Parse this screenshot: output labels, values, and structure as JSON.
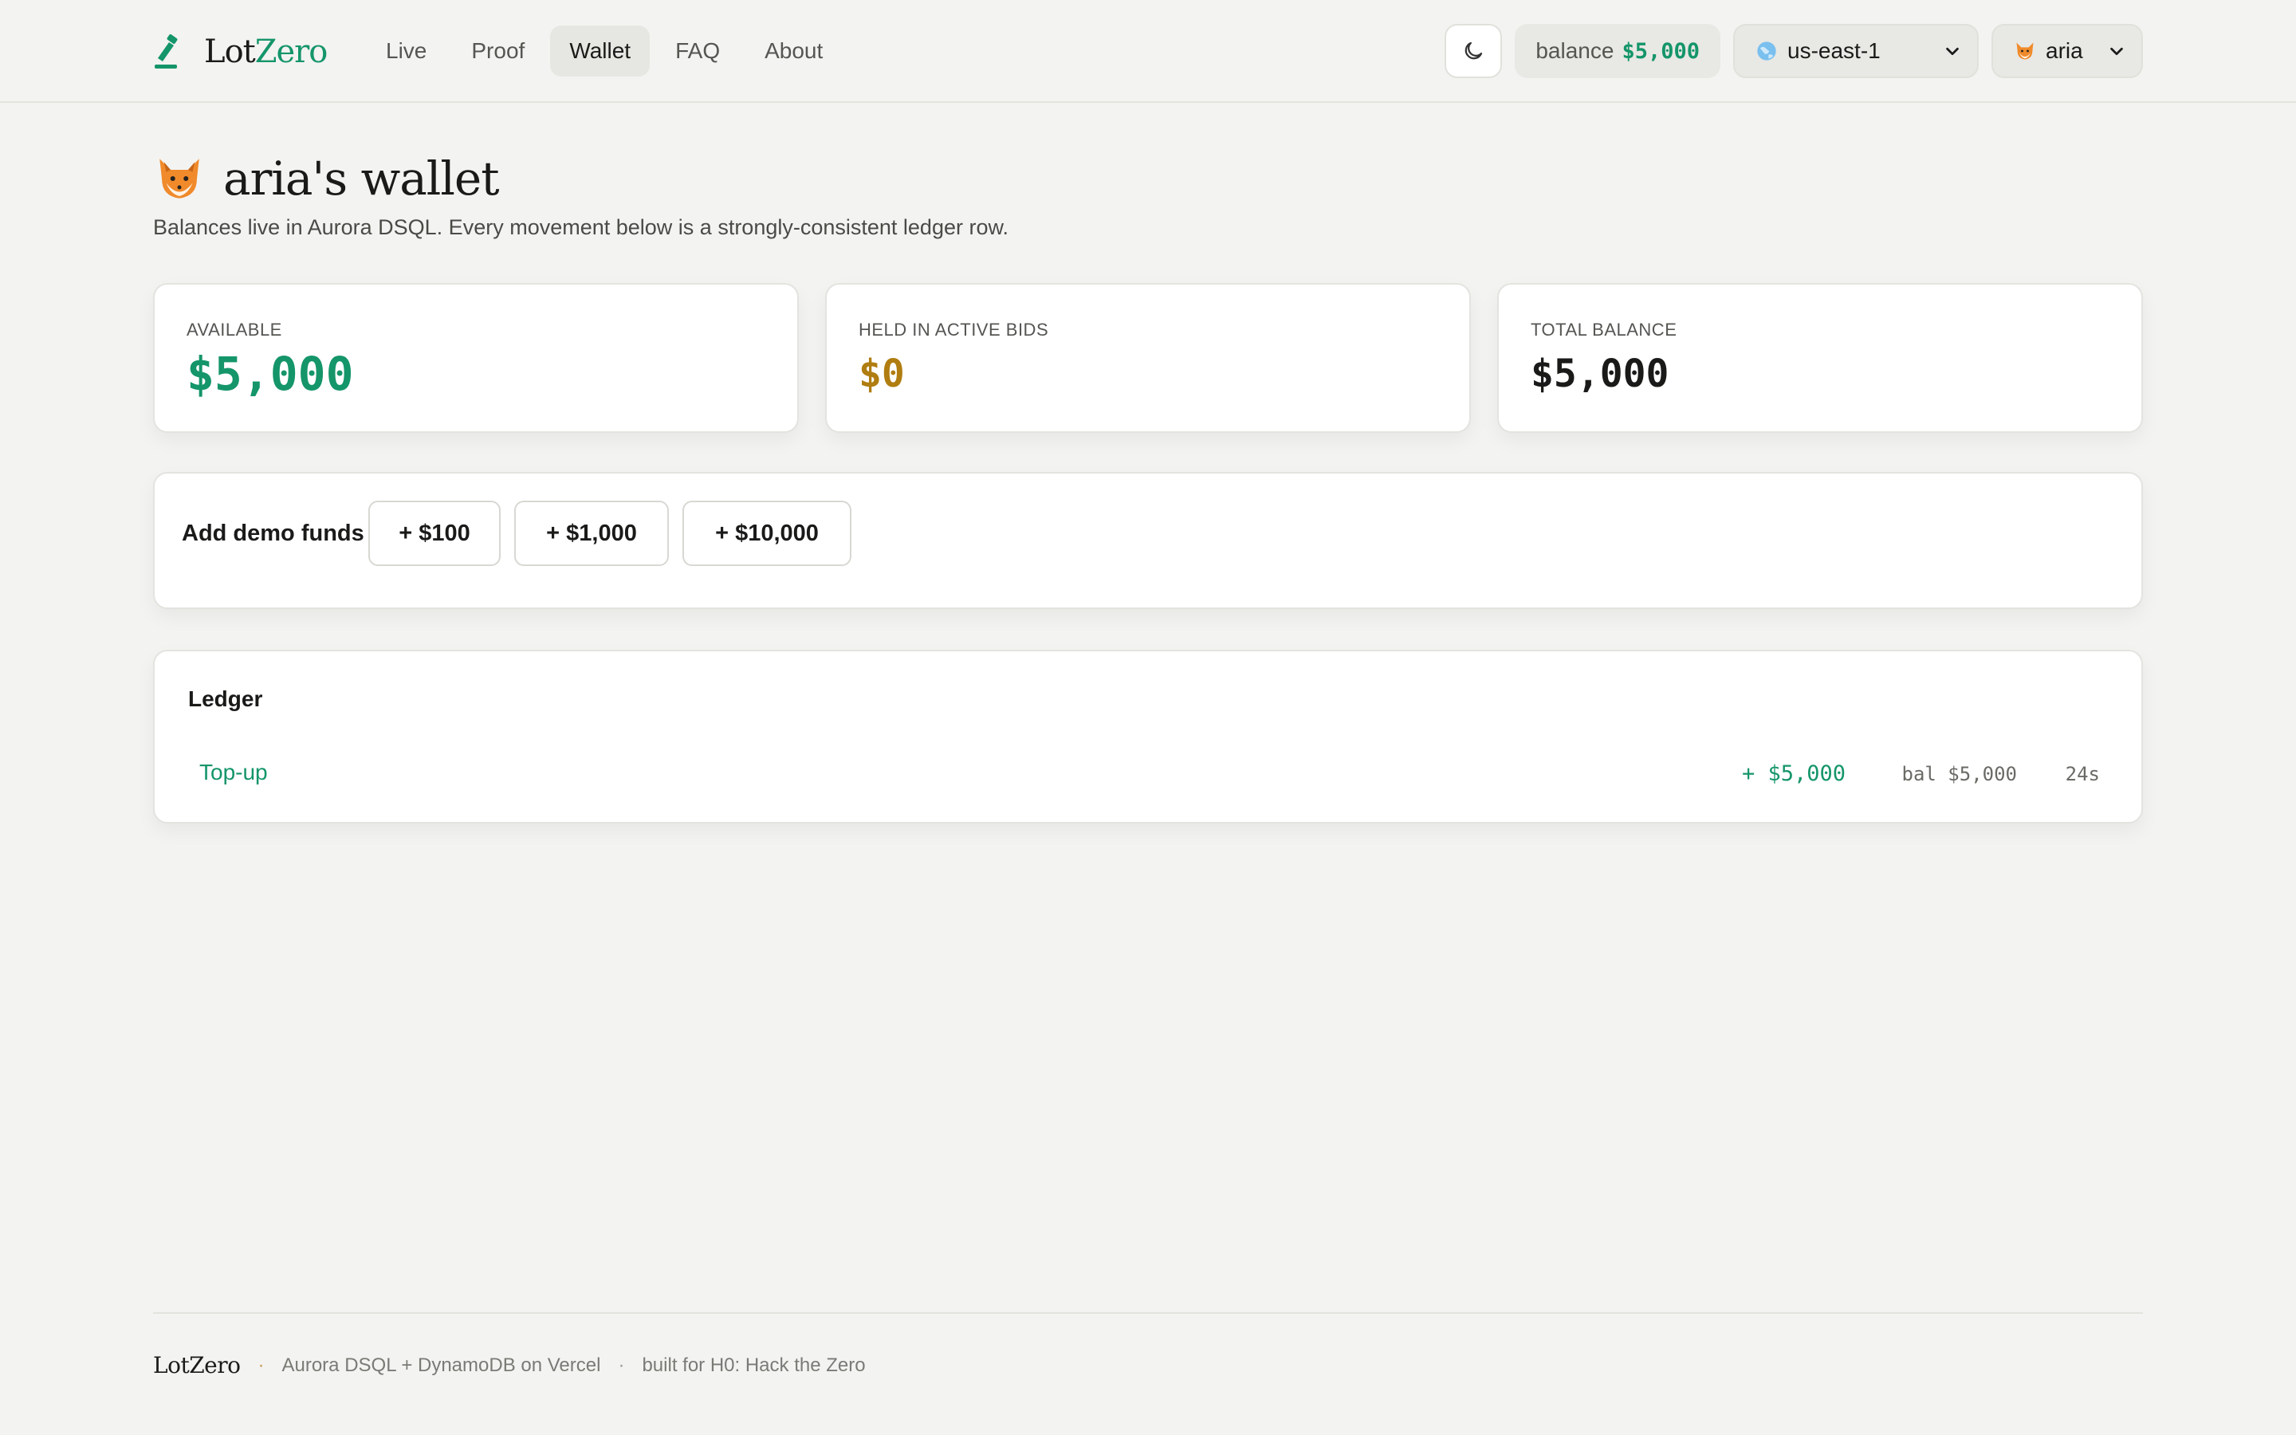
{
  "brand": {
    "name_prefix": "Lot",
    "name_accent": "Zero",
    "accent_color": "#14956a"
  },
  "nav": {
    "items": [
      {
        "label": "Live"
      },
      {
        "label": "Proof"
      },
      {
        "label": "Wallet",
        "active": true
      },
      {
        "label": "FAQ"
      },
      {
        "label": "About"
      }
    ]
  },
  "header": {
    "theme_icon": "moon-icon",
    "balance_label": "balance",
    "balance_value": "$5,000",
    "region": {
      "icon": "globe-icon",
      "selected": "us-east-1"
    },
    "user": {
      "icon": "fox-icon",
      "selected": "aria"
    }
  },
  "page": {
    "title": "aria's wallet",
    "title_icon": "fox-icon",
    "subtitle": "Balances live in Aurora DSQL. Every movement below is a strongly-consistent ledger row."
  },
  "stats": [
    {
      "label": "AVAILABLE",
      "value": "$5,000",
      "color": "#14956a"
    },
    {
      "label": "HELD IN ACTIVE BIDS",
      "value": "$0",
      "color": "#b07d10"
    },
    {
      "label": "TOTAL BALANCE",
      "value": "$5,000",
      "color": "#1a1a19"
    }
  ],
  "funds": {
    "label": "Add demo funds",
    "buttons": [
      "+ $100",
      "+ $1,000",
      "+ $10,000"
    ]
  },
  "ledger": {
    "title": "Ledger",
    "rows": [
      {
        "kind": "Top-up",
        "amount": "+ $5,000",
        "balance": "bal $5,000",
        "age": "24s"
      }
    ]
  },
  "footer": {
    "brand": "LotZero",
    "stack": "Aurora DSQL + DynamoDB on Vercel",
    "credit": "built for H0: Hack the Zero"
  }
}
